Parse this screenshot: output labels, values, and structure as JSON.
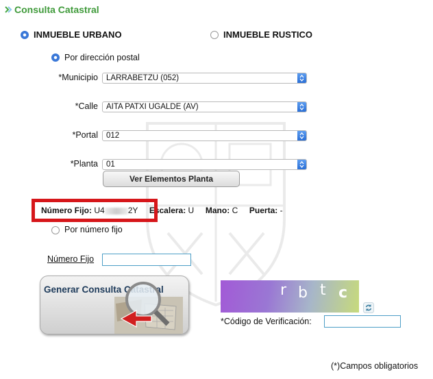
{
  "title": "Consulta Catastral",
  "property_type": {
    "urbano_label": "INMUEBLE URBANO",
    "rustico_label": "INMUEBLE RUSTICO",
    "selected": "urbano"
  },
  "search_mode": {
    "postal_label": "Por dirección postal",
    "numero_label": "Por número fijo",
    "selected": "postal"
  },
  "fields": {
    "municipio_label": "*Municipio",
    "municipio_value": "LARRABETZU (052)",
    "calle_label": "*Calle",
    "calle_value": "AITA PATXI UGALDE (AV)",
    "portal_label": "*Portal",
    "portal_value": "012",
    "planta_label": "*Planta",
    "planta_value": "01"
  },
  "ver_elementos_label": "Ver Elementos Planta",
  "info": {
    "numero_fijo_label": "Número Fijo:",
    "numero_fijo_prefix": "U4",
    "numero_fijo_suffix": "2Y",
    "escalera_label": "Escalera:",
    "escalera_value": "U",
    "mano_label": "Mano:",
    "mano_value": "C",
    "puerta_label": "Puerta:",
    "puerta_value": "-"
  },
  "numero_fijo_field_label": "Número Fijo",
  "generar_label": "Generar Consulta Catastral",
  "captcha": {
    "chars": [
      "r",
      "b",
      "t",
      "c"
    ],
    "verification_label": "*Código de Verificación:"
  },
  "required_note": "(*)Campos obligatorios",
  "colors": {
    "title_green": "#3f9a3a",
    "highlight_red": "#d6161a",
    "input_border": "#4c9dc6"
  }
}
